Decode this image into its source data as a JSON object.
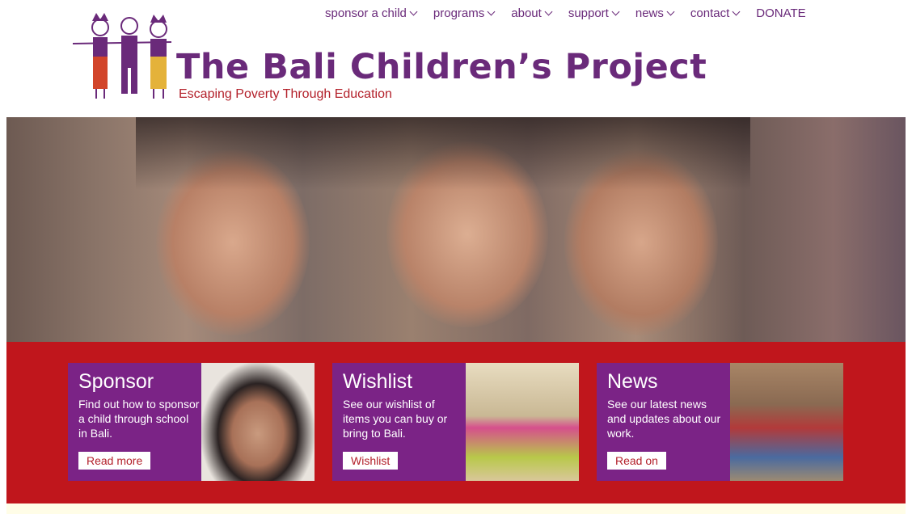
{
  "brand": {
    "title": "The Bali Children’s Project",
    "tagline": "Escaping Poverty Through Education"
  },
  "nav": [
    {
      "label": "sponsor a child",
      "has_menu": true
    },
    {
      "label": "programs",
      "has_menu": true
    },
    {
      "label": "about",
      "has_menu": true
    },
    {
      "label": "support",
      "has_menu": true
    },
    {
      "label": "news",
      "has_menu": true
    },
    {
      "label": "contact",
      "has_menu": true
    },
    {
      "label": "DONATE",
      "has_menu": false
    }
  ],
  "cards": [
    {
      "title": "Sponsor",
      "text": "Find out how to sponsor a child through school in Bali.",
      "button": "Read more"
    },
    {
      "title": "Wishlist",
      "text": "See our wishlist of items you can buy or bring to Bali.",
      "button": "Wishlist"
    },
    {
      "title": "News",
      "text": "See our latest news and updates about our work.",
      "button": "Read on"
    }
  ],
  "colors": {
    "purple": "#7b2386",
    "red": "#c0161c",
    "nav_text": "#6a2a7a",
    "tagline": "#b3202a"
  }
}
